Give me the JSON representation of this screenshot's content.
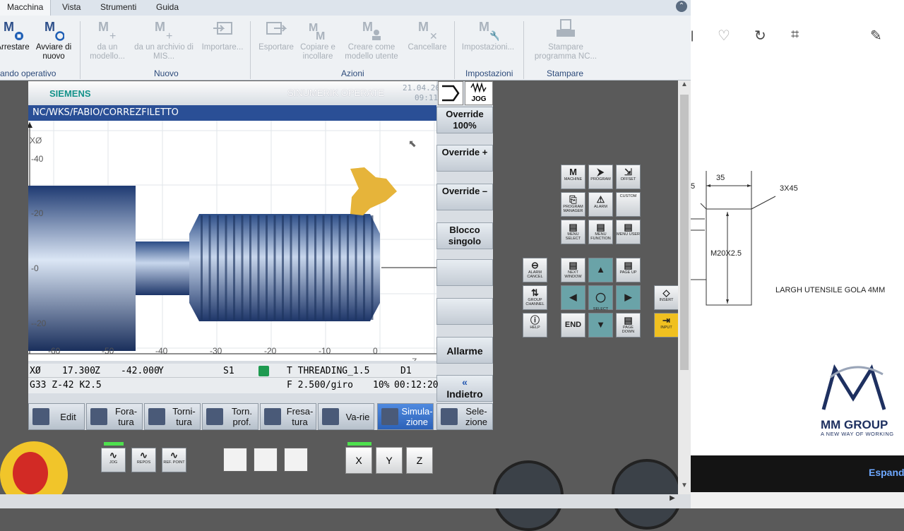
{
  "ribbon": {
    "tabs": [
      "Macchina",
      "Vista",
      "Strumenti",
      "Guida"
    ],
    "buttons": [
      {
        "label": "Arrestare",
        "icon": "machine-stop-icon",
        "enabled": true
      },
      {
        "label": "Avviare di nuovo",
        "icon": "machine-restart-icon",
        "enabled": true
      },
      {
        "label": "da un modello...",
        "icon": "new-from-template-icon",
        "enabled": false
      },
      {
        "label": "da un archivio di MIS...",
        "icon": "new-from-archive-icon",
        "enabled": false
      },
      {
        "label": "Importare...",
        "icon": "import-icon",
        "enabled": false
      },
      {
        "label": "Esportare",
        "icon": "export-icon",
        "enabled": false
      },
      {
        "label": "Copiare e incollare",
        "icon": "copy-paste-icon",
        "enabled": false
      },
      {
        "label": "Creare come modello utente",
        "icon": "user-template-icon",
        "enabled": false
      },
      {
        "label": "Cancellare",
        "icon": "delete-icon",
        "enabled": false
      },
      {
        "label": "Impostazioni...",
        "icon": "settings-icon",
        "enabled": false
      },
      {
        "label": "Stampare programma NC...",
        "icon": "print-icon",
        "enabled": false
      }
    ],
    "groups": [
      "ando operativo",
      "Nuovo",
      "Azioni",
      "Impostazioni",
      "Stampare"
    ]
  },
  "hmi": {
    "brand": "SIEMENS",
    "product": "SINUMERIK OPERATE",
    "date": "21.04.20",
    "time": "09:11",
    "mode": "JOG",
    "path": "NC/WKS/FABIO/CORREZFILETTO",
    "softkeys_right": [
      "Override 100%",
      "Override +",
      "Override –",
      "Blocco singolo",
      "",
      "",
      "Allarme",
      "Indietro"
    ],
    "axis": {
      "x_label": "XØ",
      "z_label": "Z",
      "x_ticks": [
        "40",
        "20",
        "0",
        "-20"
      ],
      "z_ticks": [
        "-60",
        "-50",
        "-40",
        "-30",
        "-20",
        "-10",
        "0"
      ]
    },
    "status": {
      "x_axis": "XØ",
      "x_val": "17.300",
      "z_axis": "Z",
      "z_val": "-42.000",
      "y_axis": "Y",
      "spindle": "S1",
      "tool": "T THREADING_1.5",
      "d": "D1",
      "block": "G33 Z-42 K2.5",
      "feed": "F 2.500/giro",
      "percent": "10%",
      "timer": "00:12:20"
    },
    "softkeys_bottom": [
      "Edit",
      "Fora-tura",
      "Torni-tura",
      "Torn. prof.",
      "Fresa-tura",
      "Va-rie",
      "Simula-zione",
      "Sele-zione"
    ],
    "active_softkey": "Simula-zione"
  },
  "panel": {
    "keys": [
      {
        "icon": "M",
        "label": "MACHINE"
      },
      {
        "icon": "⮞",
        "label": "PROGRAM"
      },
      {
        "icon": "⇲",
        "label": "OFFSET"
      },
      {
        "icon": "⎘",
        "label": "PROGRAM MANAGER"
      },
      {
        "icon": "⚠",
        "label": "ALARM"
      },
      {
        "icon": "",
        "label": "CUSTOM"
      },
      {
        "icon": "▤",
        "label": "MENU SELECT"
      },
      {
        "icon": "▤",
        "label": "MENU FUNCTION"
      },
      {
        "icon": "▤",
        "label": "MENU USER"
      }
    ],
    "nav": {
      "alarm_cancel": "ALARM CANCEL",
      "next_window": "NEXT WINDOW",
      "page_up": "PAGE UP",
      "group_channel": "GROUP CHANNEL",
      "select": "SELECT",
      "help": "HELP",
      "end": "END",
      "page_down": "PAGE DOWN",
      "insert": "INSERT",
      "input": "INPUT"
    },
    "lower_keys": [
      "JOG",
      "REPOS",
      "REF. POINT"
    ],
    "axis_keys": [
      "X",
      "Y",
      "Z"
    ]
  },
  "drawing": {
    "dim1": "35",
    "dim2": "3X45",
    "dim_left": "5",
    "thread": "M20X2.5",
    "note": "LARGH UTENSILE GOLA 4MM"
  },
  "logo": {
    "name": "MM GROUP",
    "tagline": "A NEW WAY OF WORKING"
  },
  "espand": "Espand"
}
